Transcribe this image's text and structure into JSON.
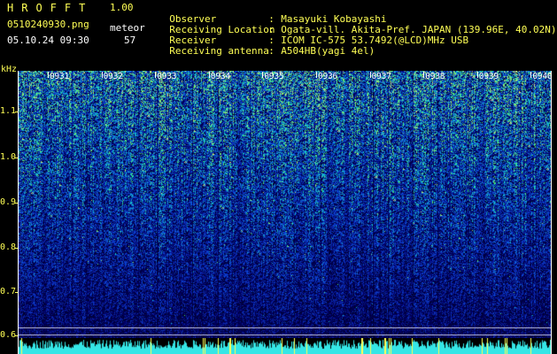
{
  "header": {
    "brand": "HROFFT",
    "version": "1.00",
    "filename": "0510240930.png",
    "datetime": "05.10.24 09:30",
    "meteor_label": "meteor",
    "meteor_count": "57"
  },
  "info": [
    {
      "label": "Observer",
      "value": "Masayuki Kobayashi"
    },
    {
      "label": "Receiving Location",
      "value": "Ogata-vill. Akita-Pref. JAPAN (139.96E, 40.02N)"
    },
    {
      "label": "Receiver",
      "value": "ICOM IC-575 53.7492(@LCD)MHz USB"
    },
    {
      "label": "Receiving antenna",
      "value": "A504HB(yagi 4el)"
    }
  ],
  "axis": {
    "y_unit": "kHz",
    "y_ticks": [
      "1.1",
      "1.0",
      "0.9",
      "0.8",
      "0.7",
      "0.6"
    ],
    "time_ticks": [
      "0931",
      "0932",
      "0933",
      "0934",
      "0935",
      "0936",
      "0937",
      "0938",
      "0939",
      "0940"
    ]
  },
  "colors": {
    "label": "#ffff55",
    "background": "#000000",
    "spectrum_low": "#0a1a6e",
    "spectrum_high": "#3fe0c8"
  }
}
